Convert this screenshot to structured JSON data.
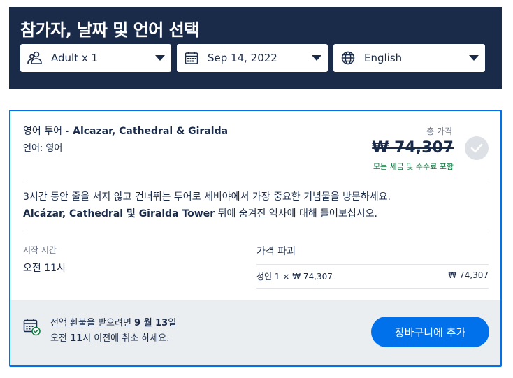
{
  "header": {
    "title": "참가자, 날짜 및 언어 선택",
    "participants": {
      "value": "Adult x 1",
      "icon": "people-icon"
    },
    "date": {
      "value": "Sep 14, 2022",
      "icon": "calendar-icon"
    },
    "language": {
      "value": "English",
      "icon": "globe-icon"
    }
  },
  "option": {
    "title_prefix": "영어 투어",
    "title_name": "- Alcazar, Cathedral & Giralda",
    "language_line": "언어: 영어",
    "total_label": "총 가격",
    "price": "₩ 74,307",
    "price_note": "모든 세금 및 수수료 포함",
    "description_line1": "3시간 동안 줄을 서지 않고 건너뛰는 투어로 세비야에서 가장 중요한 기념물을 방문하세요.",
    "description_bold": "Alcázar, Cathedral 및 Giralda Tower",
    "description_line2_rest": " 뒤에 숨겨진 역사에 대해 들어보십시오.",
    "start_label": "시작 시간",
    "start_value": "오전 11시",
    "breakdown_label": "가격 파괴",
    "breakdown_item": "성인 1 × ₩ 74,307",
    "breakdown_total": "₩ 74,307",
    "cancel_pre": "전액 환불을 받으려면 ",
    "cancel_date": "9 월 13",
    "cancel_post": "일",
    "cancel_line2_pre": "오전 ",
    "cancel_time": "11",
    "cancel_line2_post": "시 이전에 취소 하세요.",
    "cart_button": "장바구니에 추가"
  },
  "colors": {
    "navy": "#1a2b49",
    "accent": "#0071eb",
    "success": "#0a7a3e",
    "footer_bg": "#ebeef1"
  }
}
